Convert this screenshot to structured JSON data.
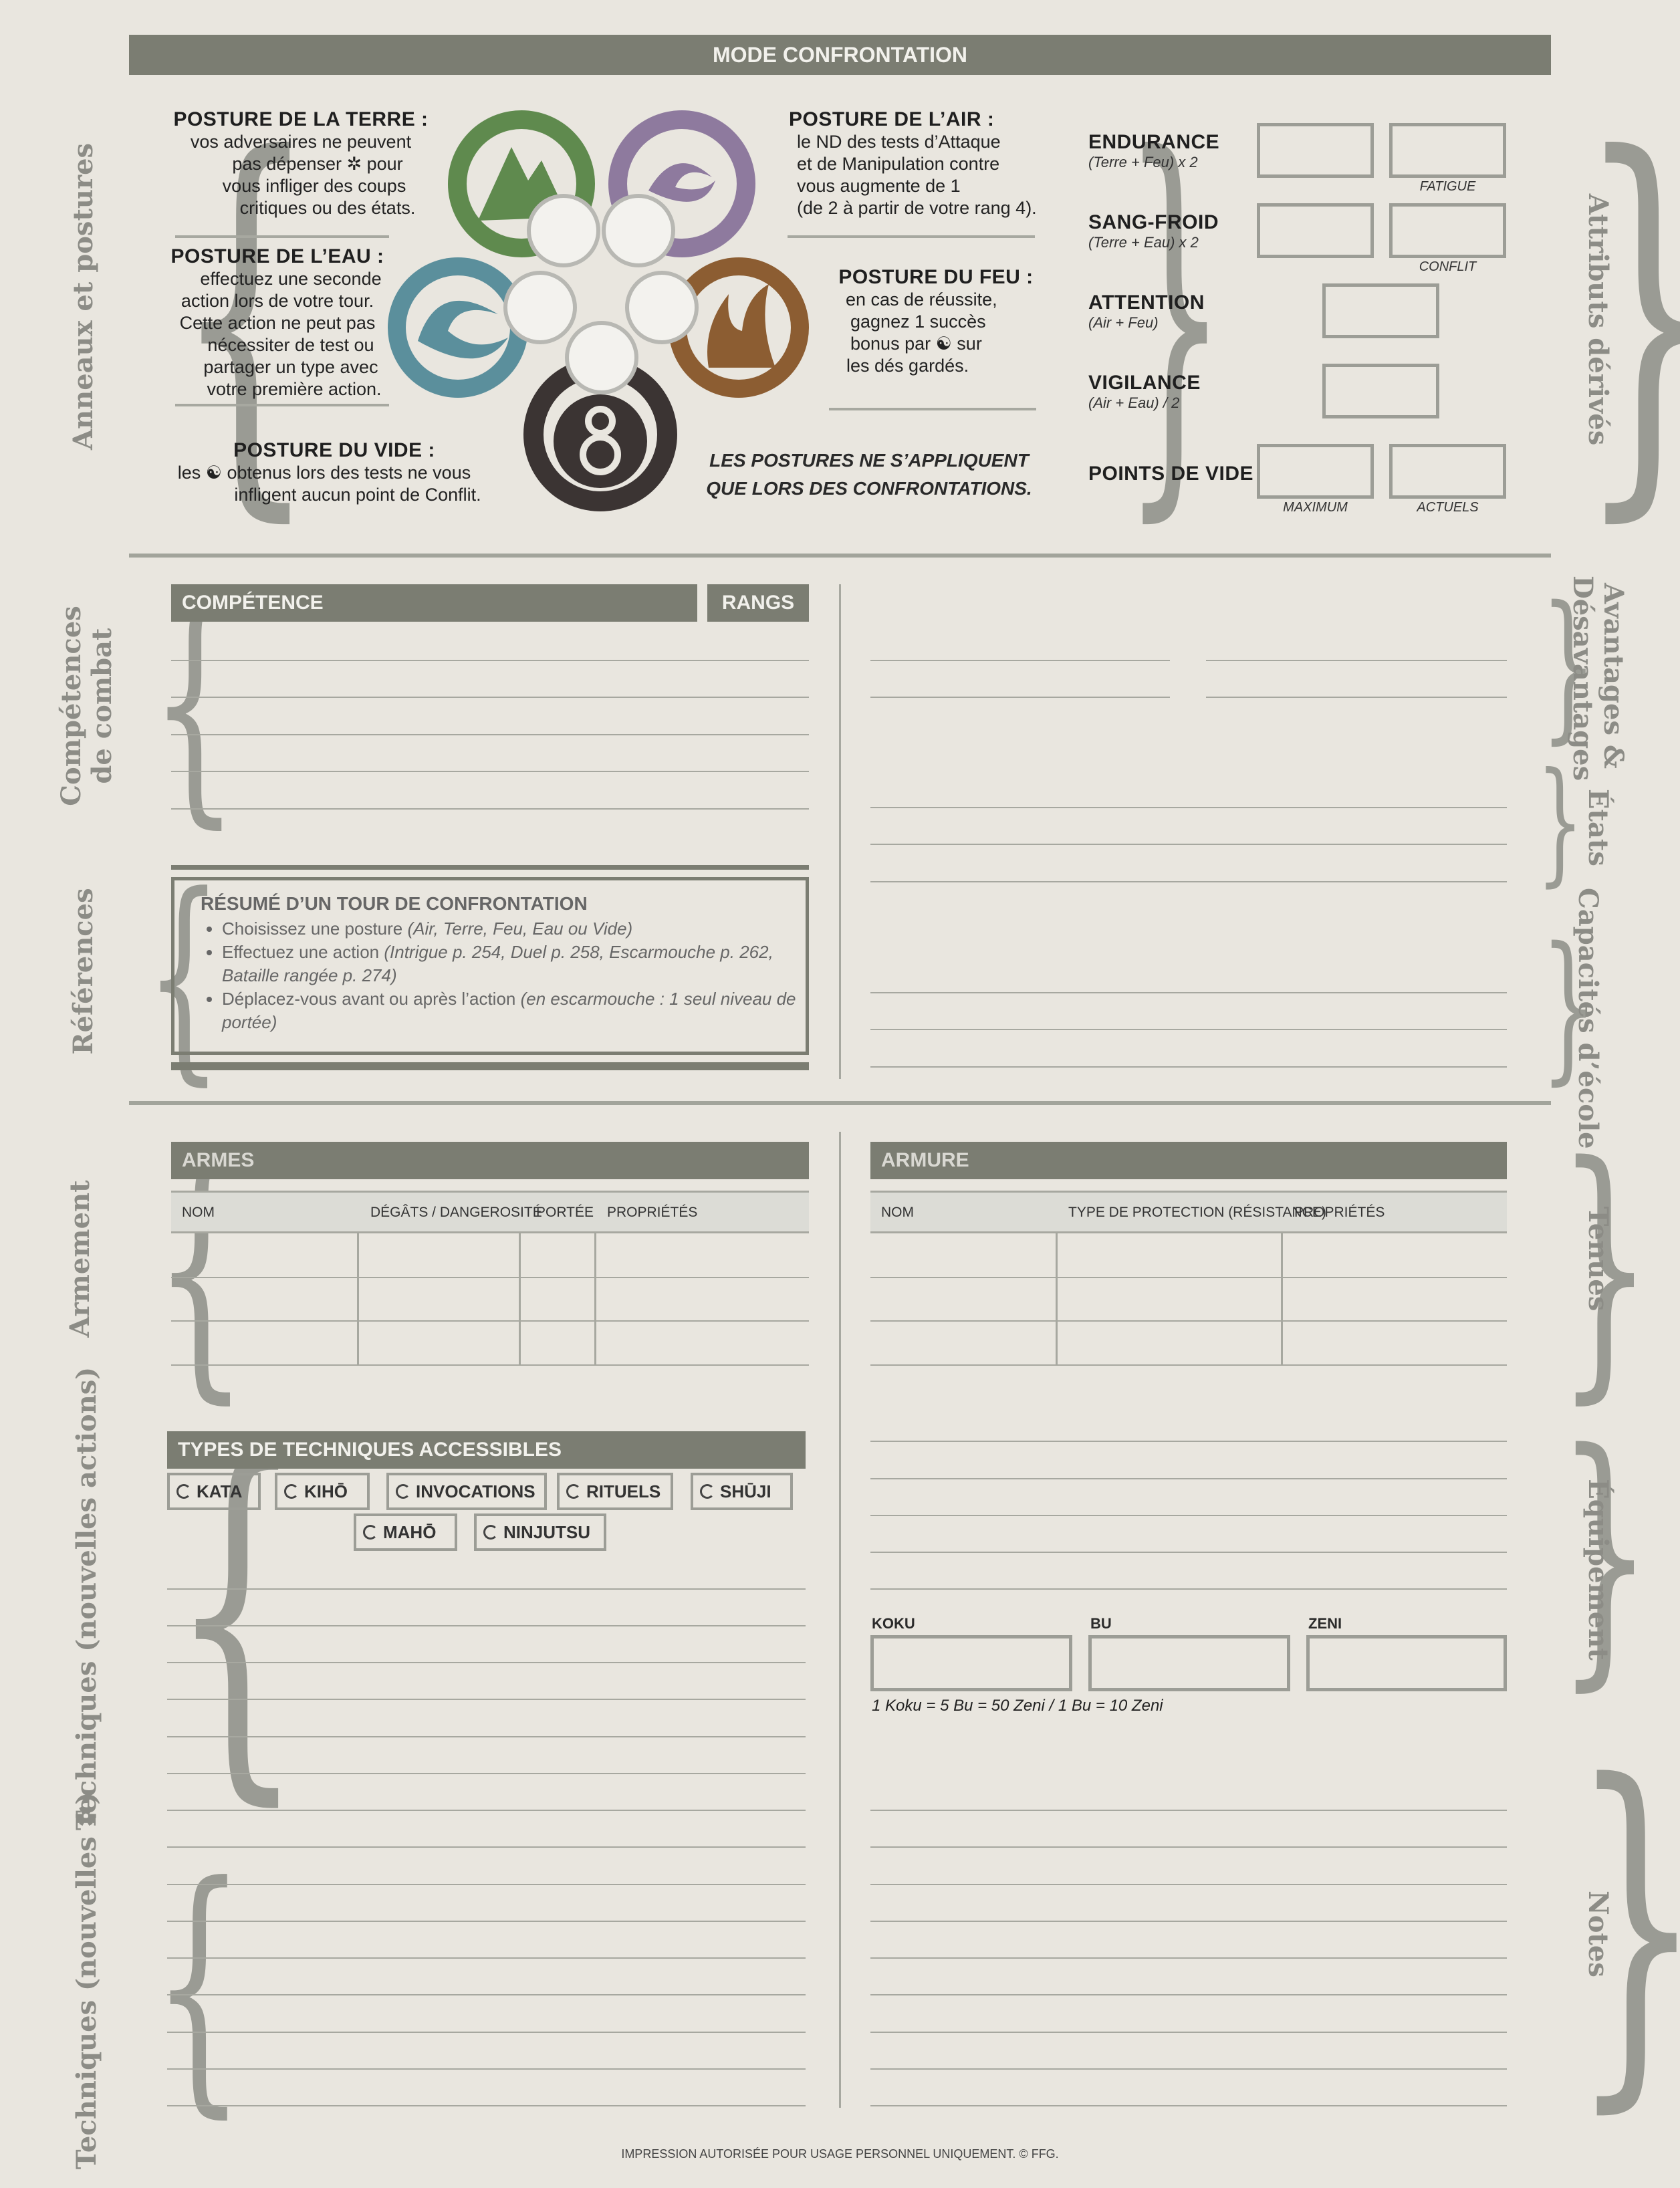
{
  "header": {
    "title": "MODE CONFRONTATION"
  },
  "side_labels": {
    "left": [
      "Anneaux et postures",
      "Compétences\nde combat",
      "Références",
      "Armement",
      "Techniques (nouvelles actions)",
      "Techniques (nouvelles ✲)"
    ],
    "right": [
      "Attributs dérivés",
      "Avantages &\nDésavantages",
      "États",
      "Capacités d’école",
      "Tenues",
      "Équipement",
      "Notes"
    ]
  },
  "postures": {
    "earth": {
      "title": "POSTURE DE LA TERRE :",
      "lines": [
        "vos adversaires ne peuvent",
        "pas dépenser ✲ pour",
        "vous infliger des coups",
        "critiques ou des états."
      ]
    },
    "water": {
      "title": "POSTURE DE L’EAU :",
      "lines": [
        "effectuez une seconde",
        "action lors de votre tour.",
        "Cette action ne peut pas",
        "nécessiter de test ou",
        "partager un type avec",
        "votre première action."
      ]
    },
    "void": {
      "title": "POSTURE DU VIDE :",
      "lines": [
        "les ☯ obtenus lors des tests ne vous",
        "infligent aucun point de Conflit."
      ]
    },
    "air": {
      "title": "POSTURE DE L’AIR :",
      "lines": [
        "le ND des tests d’Attaque",
        "et de Manipulation contre",
        "vous augmente de 1",
        "(de 2 à partir de votre rang 4)."
      ]
    },
    "fire": {
      "title": "POSTURE DU FEU :",
      "lines": [
        "en cas de réussite,",
        "gagnez 1 succès",
        "bonus par ☯ sur",
        "les dés gardés."
      ]
    },
    "note": [
      "LES POSTURES NE S’APPLIQUENT",
      "QUE LORS DES CONFRONTATIONS."
    ],
    "ring_colors": {
      "earth": "#5f8a4e",
      "air": "#8e7a9e",
      "water": "#5b8f9c",
      "fire": "#8c5d32",
      "void": "#3b3433"
    }
  },
  "attributes": {
    "endurance": {
      "label": "ENDURANCE",
      "formula": "(Terre + Feu) x 2",
      "box2_caption": "FATIGUE"
    },
    "composure": {
      "label": "SANG-FROID",
      "formula": "(Terre + Eau) x 2",
      "box2_caption": "CONFLIT"
    },
    "focus": {
      "label": "ATTENTION",
      "formula": "(Air + Feu)"
    },
    "vigilance": {
      "label": "VIGILANCE",
      "formula": "(Air + Eau) / 2"
    },
    "void_points": {
      "label": "POINTS DE VIDE",
      "cap1": "MAXIMUM",
      "cap2": "ACTUELS"
    }
  },
  "skills": {
    "col1": "COMPÉTENCE",
    "col2": "RANGS"
  },
  "summary": {
    "title": "RÉSUMÉ D’UN TOUR DE CONFRONTATION",
    "items": [
      {
        "main": "Choisissez une posture ",
        "it": "(Air, Terre, Feu, Eau ou Vide)"
      },
      {
        "main": "Effectuez une action ",
        "it": "(Intrigue p. 254, Duel p. 258, Escarmouche p. 262, Bataille rangée p. 274)"
      },
      {
        "main": "Déplacez-vous avant ou après l’action ",
        "it": "(en escarmouche : 1 seul niveau de portée)"
      }
    ]
  },
  "weapons": {
    "title": "ARMES",
    "cols": [
      "NOM",
      "DÉGÂTS / DANGEROSITÉ",
      "PORTÉE",
      "PROPRIÉTÉS"
    ]
  },
  "armor": {
    "title": "ARMURE",
    "cols": [
      "NOM",
      "TYPE DE PROTECTION (RÉSISTANCE)",
      "PROPRIÉTÉS"
    ]
  },
  "techniques": {
    "title": "TYPES DE TECHNIQUES ACCESSIBLES",
    "types": [
      "KATA",
      "KIHŌ",
      "INVOCATIONS",
      "RITUELS",
      "SHŪJI",
      "MAHŌ",
      "NINJUTSU"
    ]
  },
  "money": {
    "koku": "KOKU",
    "bu": "BU",
    "zeni": "ZENI",
    "rate": "1 Koku = 5 Bu = 50 Zeni / 1 Bu = 10 Zeni"
  },
  "footer": "IMPRESSION AUTORISÉE POUR USAGE PERSONNEL UNIQUEMENT. © FFG."
}
